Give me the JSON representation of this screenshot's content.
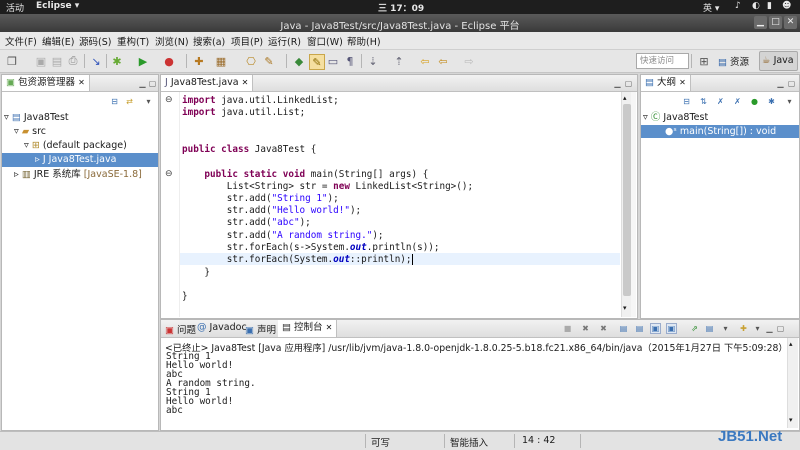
{
  "system_bar": {
    "activities": "活动",
    "app": "Eclipse ▾",
    "clock": "三 17：09",
    "lang": "英 ▾"
  },
  "window": {
    "title": "Java - Java8Test/src/Java8Test.java - Eclipse 平台"
  },
  "menu": [
    "文件(F)",
    "编辑(E)",
    "源码(S)",
    "重构(T)",
    "浏览(N)",
    "搜索(a)",
    "项目(P)",
    "运行(R)",
    "窗口(W)",
    "帮助(H)"
  ],
  "toolbar": {
    "quick_access_placeholder": "快速访问",
    "perspective_resource": "资源",
    "perspective_java": "Java"
  },
  "package_explorer": {
    "tab": "包资源管理器",
    "tree": [
      {
        "label": "Java8Test"
      },
      {
        "label": "src"
      },
      {
        "label": "(default package)"
      },
      {
        "label": "Java8Test.java"
      },
      {
        "label": "JRE 系统库",
        "suffix": "[JavaSE-1.8]"
      }
    ]
  },
  "editor": {
    "tab": "Java8Test.java",
    "lines": [
      "import java.util.LinkedList;",
      "import java.util.List;",
      "",
      "",
      "public class Java8Test {",
      "",
      "    public static void main(String[] args) {",
      "        List<String> str = new LinkedList<String>();",
      "        str.add(\"String 1\");",
      "        str.add(\"Hello world!\");",
      "        str.add(\"abc\");",
      "        str.add(\"A random string.\");",
      "        str.forEach(s->System.out.println(s));",
      "        str.forEach(System.out::println);",
      "    }",
      "",
      "}"
    ]
  },
  "outline": {
    "tab": "大纲",
    "class": "Java8Test",
    "method": "main(String[]) : void"
  },
  "bottom_tabs": {
    "problems": "问题",
    "javadoc": "Javadoc",
    "declaration": "声明",
    "console": "控制台"
  },
  "console": {
    "header": "<已终止> Java8Test [Java 应用程序] /usr/lib/jvm/java-1.8.0-openjdk-1.8.0.25-5.b18.fc21.x86_64/bin/java（2015年1月27日 下午5:09:28）",
    "lines": [
      "String 1",
      "Hello world!",
      "abc",
      "A random string.",
      "String 1",
      "Hello world!",
      "abc"
    ]
  },
  "status": {
    "writable": "可写",
    "insert": "智能插入",
    "position": "14 : 42"
  },
  "watermark": "JB51.Net"
}
